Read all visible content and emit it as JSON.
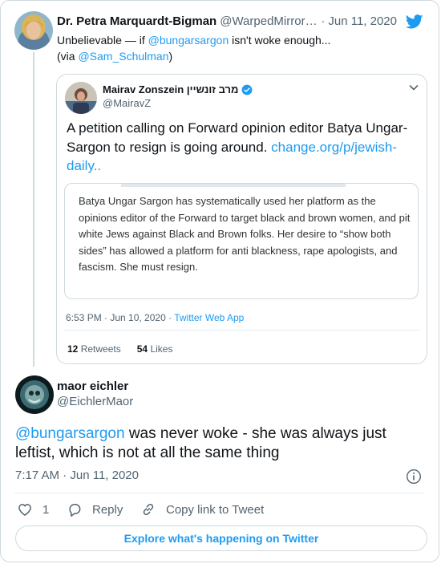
{
  "parent": {
    "name": "Dr. Petra Marquardt-Bigman",
    "handle": "@WarpedMirrorP…",
    "separator": "·",
    "date": "Jun 11, 2020",
    "text_before": "Unbelievable — if ",
    "mention": "@bungarsargon",
    "text_after": " isn't woke enough...",
    "via_open": "(via ",
    "via_mention": "@Sam_Schulman",
    "via_close": ")"
  },
  "quoted": {
    "name": "Mairav Zonszein מרב זונשיין",
    "handle": "@MairavZ",
    "text": "A petition calling on Forward opinion editor Batya Ungar-Sargon to resign is going around. ",
    "link": "change.org/p/jewish-daily..",
    "image_text": "Batya Ungar Sargon has systematically used her platform as the opinions editor of the Forward to target black and brown women, and pit white Jews against Black and Brown folks. Her desire to “show both sides” has allowed a platform for anti blackness, rape apologists, and fascism. She must resign.",
    "time": "6:53 PM · Jun 10, 2020 · ",
    "app": "Twitter Web App",
    "retweets_count": "12",
    "retweets_label": "Retweets",
    "likes_count": "54",
    "likes_label": "Likes"
  },
  "main": {
    "name": "maor eichler",
    "handle": "@EichlerMaor",
    "mention": "@bungarsargon",
    "text": " was never woke - she was always just leftist, which is not at all the same thing",
    "time": "7:17 AM · Jun 11, 2020",
    "likes_count": "1",
    "reply_label": "Reply",
    "copy_label": "Copy link to Tweet"
  },
  "explore_label": "Explore what's happening on Twitter",
  "colors": {
    "accent": "#1d9bf0",
    "muted": "#536471",
    "border": "#cfd9de",
    "like": "#536471"
  },
  "icons": [
    "twitter-bird-icon",
    "verified-badge-icon",
    "chevron-down-icon",
    "info-icon",
    "heart-icon",
    "reply-icon",
    "link-icon"
  ]
}
